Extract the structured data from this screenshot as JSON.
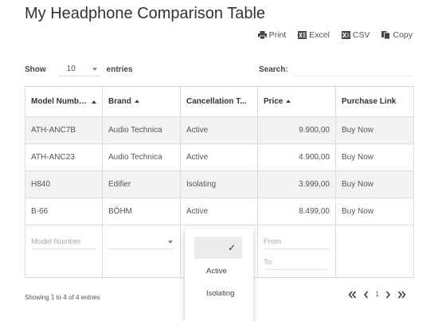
{
  "page": {
    "title": "My Headphone Comparison Table"
  },
  "toolbar": {
    "print_label": "Print",
    "excel_label": "Excel",
    "csv_label": "CSV",
    "copy_label": "Copy"
  },
  "length": {
    "show_label": "Show",
    "value": "10",
    "entries_label": "entries"
  },
  "search": {
    "label": "Search:",
    "value": ""
  },
  "table": {
    "headers": [
      {
        "label": "Model Numbe...",
        "sorted": "asc"
      },
      {
        "label": "Brand",
        "sorted": "asc"
      },
      {
        "label": "Cancellation T...",
        "sorted": ""
      },
      {
        "label": "Price",
        "sorted": "asc"
      },
      {
        "label": "Purchase Link",
        "sorted": ""
      }
    ],
    "rows": [
      {
        "model": "ATH-ANC7B",
        "brand": "Audio Technica",
        "cancellation": "Active",
        "price": "9.900,00",
        "link": "Buy Now"
      },
      {
        "model": "ATH-ANC23",
        "brand": "Audio Technica",
        "cancellation": "Active",
        "price": "4.900,00",
        "link": "Buy Now"
      },
      {
        "model": "H840",
        "brand": "Edifier",
        "cancellation": "Isolating",
        "price": "3.999,00",
        "link": "Buy Now"
      },
      {
        "model": "B-66",
        "brand": "BÖHM",
        "cancellation": "Active",
        "price": "8.499,00",
        "link": "Buy Now"
      }
    ],
    "filters": {
      "model_placeholder": "Model Number",
      "price_from_placeholder": "From",
      "price_to_placeholder": "To"
    }
  },
  "dropdown": {
    "check_mark": "✓",
    "options": [
      "Active",
      "Isolating"
    ]
  },
  "info": {
    "text": "Showing 1 to 4 of 4 entries"
  },
  "pagination": {
    "first": "«",
    "prev": "‹",
    "current": "1",
    "next": "›",
    "last": "»"
  }
}
